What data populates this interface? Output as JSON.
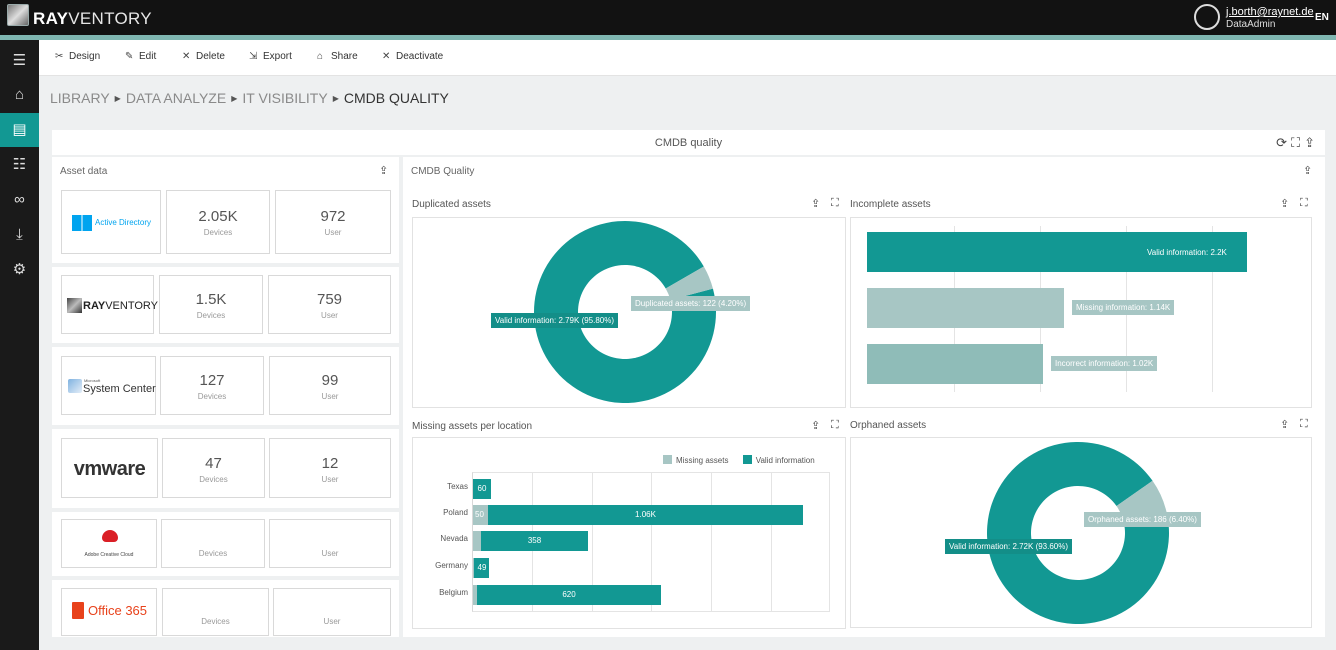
{
  "header": {
    "logo_bold": "RAY",
    "logo_light": "VENTORY",
    "user_email": "j.borth@raynet.de",
    "user_role": "DataAdmin",
    "language": "EN"
  },
  "toolbar": {
    "design": "Design",
    "edit": "Edit",
    "delete": "Delete",
    "export": "Export",
    "share": "Share",
    "deactivate": "Deactivate"
  },
  "breadcrumb": {
    "items": [
      "LIBRARY",
      "DATA ANALYZE",
      "IT VISIBILITY"
    ],
    "current": "CMDB QUALITY"
  },
  "dashboard": {
    "title": "CMDB quality"
  },
  "asset_panel": {
    "title": "Asset data",
    "rows": [
      {
        "brand": "Active Directory",
        "devices_value": "2.05K",
        "devices_label": "Devices",
        "user_value": "972",
        "user_label": "User"
      },
      {
        "brand_bold": "RAY",
        "brand_light": "VENTORY",
        "devices_value": "1.5K",
        "devices_label": "Devices",
        "user_value": "759",
        "user_label": "User"
      },
      {
        "brand_small": "Microsoft",
        "brand": "System Center",
        "devices_value": "127",
        "devices_label": "Devices",
        "user_value": "99",
        "user_label": "User"
      },
      {
        "brand": "vmware",
        "devices_value": "47",
        "devices_label": "Devices",
        "user_value": "12",
        "user_label": "User"
      },
      {
        "brand": "Adobe Creative Cloud",
        "devices_value": "",
        "devices_label": "Devices",
        "user_value": "",
        "user_label": "User"
      },
      {
        "brand": "Office 365",
        "devices_value": "",
        "devices_label": "Devices",
        "user_value": "",
        "user_label": "User"
      }
    ]
  },
  "cmdb_panel": {
    "title": "CMDB Quality"
  },
  "colors": {
    "primary": "#129893",
    "light": "#a7c6c4",
    "mid": "#8fbcb8"
  },
  "chart_data": [
    {
      "type": "pie",
      "title": "Duplicated assets",
      "slices": [
        {
          "label": "Valid information",
          "value": 2790,
          "display": "Valid information: 2.79K (95.80%)"
        },
        {
          "label": "Duplicated assets",
          "value": 122,
          "display": "Duplicated assets: 122 (4.20%)"
        }
      ]
    },
    {
      "type": "bar",
      "title": "Incomplete assets",
      "orientation": "horizontal",
      "categories": [
        "Valid information",
        "Missing information",
        "Incorrect information"
      ],
      "values": [
        2200,
        1140,
        1020
      ],
      "labels": [
        "Valid information: 2.2K",
        "Missing information: 1.14K",
        "Incorrect information: 1.02K"
      ],
      "xlim": [
        0,
        2500
      ]
    },
    {
      "type": "bar",
      "title": "Missing assets per location",
      "orientation": "horizontal",
      "stacked": true,
      "categories": [
        "Texas",
        "Poland",
        "Nevada",
        "Germany",
        "Belgium"
      ],
      "series": [
        {
          "name": "Missing assets",
          "values": [
            0,
            50,
            28,
            5,
            15
          ],
          "labels": [
            "",
            "50",
            "",
            "",
            ""
          ]
        },
        {
          "name": "Valid information",
          "values": [
            60,
            1060,
            358,
            49,
            620
          ],
          "labels": [
            "60",
            "1.06K",
            "358",
            "49",
            "620"
          ]
        }
      ],
      "xlim": [
        0,
        1200
      ],
      "legend": "top-right"
    },
    {
      "type": "pie",
      "title": "Orphaned assets",
      "slices": [
        {
          "label": "Valid information",
          "value": 2720,
          "display": "Valid information: 2.72K (93.60%)"
        },
        {
          "label": "Orphaned assets",
          "value": 186,
          "display": "Orphaned assets: 186 (6.40%)"
        }
      ]
    }
  ]
}
